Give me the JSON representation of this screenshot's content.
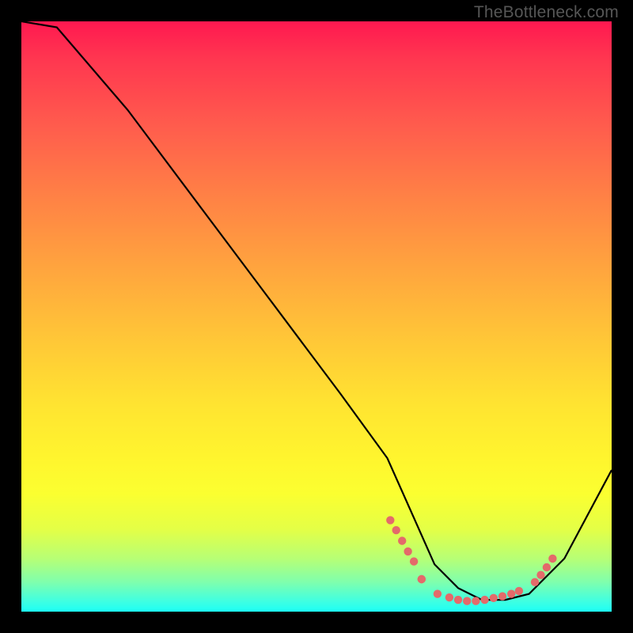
{
  "watermark": "TheBottleneck.com",
  "chart_data": {
    "type": "line",
    "title": "",
    "xlabel": "",
    "ylabel": "",
    "xlim": [
      0,
      100
    ],
    "ylim": [
      0,
      100
    ],
    "series": [
      {
        "name": "curve",
        "x": [
          0,
          6,
          18,
          30,
          42,
          54,
          62,
          66,
          70,
          74,
          78,
          82,
          86,
          92,
          100
        ],
        "values": [
          100,
          99,
          85,
          69,
          53,
          37,
          26,
          17,
          8,
          4,
          2,
          2,
          3,
          9,
          24
        ]
      },
      {
        "name": "markers-left",
        "x": [
          62.5,
          63.5,
          64.5,
          65.5,
          66.5,
          67.8,
          67.8
        ],
        "values": [
          15.5,
          13.8,
          12.0,
          10.2,
          8.5,
          5.5,
          5.5
        ]
      },
      {
        "name": "markers-bottom",
        "x": [
          70.5,
          72.5,
          74.0,
          75.5,
          77.0,
          78.5,
          80.0,
          81.5,
          83.0,
          84.3
        ],
        "values": [
          3.0,
          2.4,
          2.0,
          1.8,
          1.8,
          2.0,
          2.3,
          2.6,
          3.0,
          3.5
        ]
      },
      {
        "name": "markers-right",
        "x": [
          87.0,
          88.0,
          89.0,
          90.0
        ],
        "values": [
          5.0,
          6.2,
          7.5,
          9.0
        ]
      }
    ],
    "marker_color": "#e46a6a",
    "curve_color": "#000000",
    "background_gradient": [
      {
        "pos": 0,
        "color": "#ff1850"
      },
      {
        "pos": 6,
        "color": "#ff3550"
      },
      {
        "pos": 18,
        "color": "#ff5d4d"
      },
      {
        "pos": 30,
        "color": "#ff8245"
      },
      {
        "pos": 42,
        "color": "#ffa53e"
      },
      {
        "pos": 54,
        "color": "#ffc737"
      },
      {
        "pos": 65,
        "color": "#ffe431"
      },
      {
        "pos": 74,
        "color": "#fff52e"
      },
      {
        "pos": 80,
        "color": "#fbff30"
      },
      {
        "pos": 86,
        "color": "#e4ff46"
      },
      {
        "pos": 91,
        "color": "#b7ff75"
      },
      {
        "pos": 95,
        "color": "#7fffad"
      },
      {
        "pos": 98,
        "color": "#44ffde"
      },
      {
        "pos": 100,
        "color": "#1cfff6"
      }
    ]
  }
}
